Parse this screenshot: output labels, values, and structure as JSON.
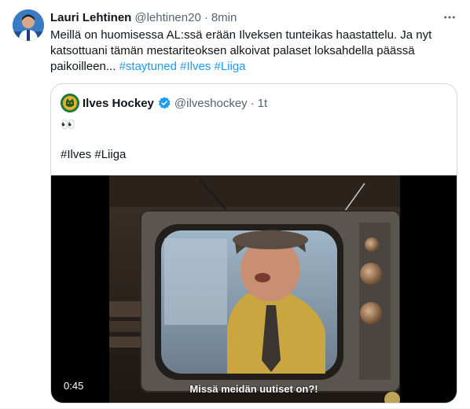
{
  "tweet": {
    "author_name": "Lauri Lehtinen",
    "author_handle": "@lehtinen20",
    "separator": "·",
    "time": "8min",
    "text_plain": "Meillä on huomisessa AL:ssä erään Ilveksen tunteikas haastattelu. Ja nyt katsottuani tämän mestariteoksen alkoivat palaset loksahdella päässä paikoilleen... ",
    "hashtags": [
      "#staytuned",
      "#Ilves",
      "#Liiga"
    ]
  },
  "quote": {
    "author_name": "Ilves Hockey",
    "author_handle": "@ilveshockey",
    "separator": "·",
    "time": "1t",
    "line1": "👀",
    "line2": "#Ilves #Liiga",
    "video": {
      "duration": "0:45",
      "subtitle": "Missä meidän uutiset on?!"
    }
  },
  "icons": {
    "more": "more-horizontal-icon",
    "verified": "verified-badge-icon"
  },
  "colors": {
    "link": "#1d9bf0",
    "secondary_text": "#536471",
    "border": "#cfd9de",
    "verified": "#1d9bf0"
  }
}
